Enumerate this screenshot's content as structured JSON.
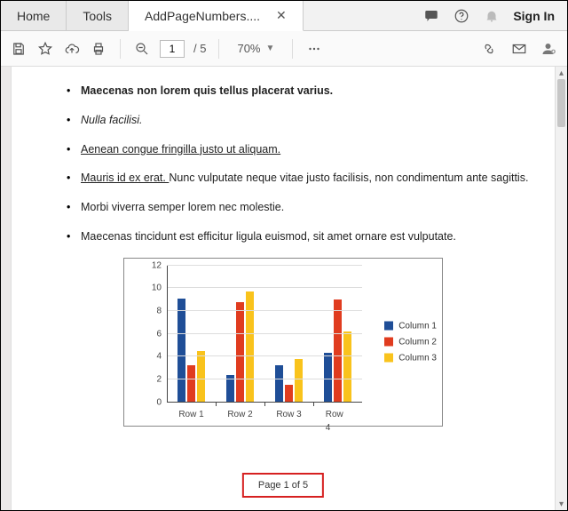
{
  "tabs": {
    "home": "Home",
    "tools": "Tools",
    "file": "AddPageNumbers...."
  },
  "signin": "Sign In",
  "toolbar": {
    "page_current": "1",
    "page_total": "/  5",
    "zoom": "70%"
  },
  "doc": {
    "b1": "Maecenas non lorem quis tellus placerat varius.",
    "b2": "Nulla facilisi.",
    "b3": "Aenean congue fringilla justo ut aliquam. ",
    "b4a": "Mauris id ex erat. ",
    "b4b": "Nunc vulputate neque vitae justo facilisis, non condimentum ante sagittis.",
    "b5": "Morbi viverra semper lorem nec molestie.",
    "b6": "Maecenas tincidunt est efficitur ligula euismod, sit amet ornare est vulputate.",
    "footer": "Page 1 of 5"
  },
  "chart_data": {
    "type": "bar",
    "categories": [
      "Row 1",
      "Row 2",
      "Row 3",
      "Row 4"
    ],
    "series": [
      {
        "name": "Column 1",
        "values": [
          9.1,
          2.4,
          3.2,
          4.3
        ]
      },
      {
        "name": "Column 2",
        "values": [
          3.2,
          8.8,
          1.5,
          9.0
        ]
      },
      {
        "name": "Column 3",
        "values": [
          4.5,
          9.7,
          3.8,
          6.2
        ]
      }
    ],
    "ylim": [
      0,
      12
    ],
    "yticks": [
      0,
      2,
      4,
      6,
      8,
      10,
      12
    ]
  }
}
